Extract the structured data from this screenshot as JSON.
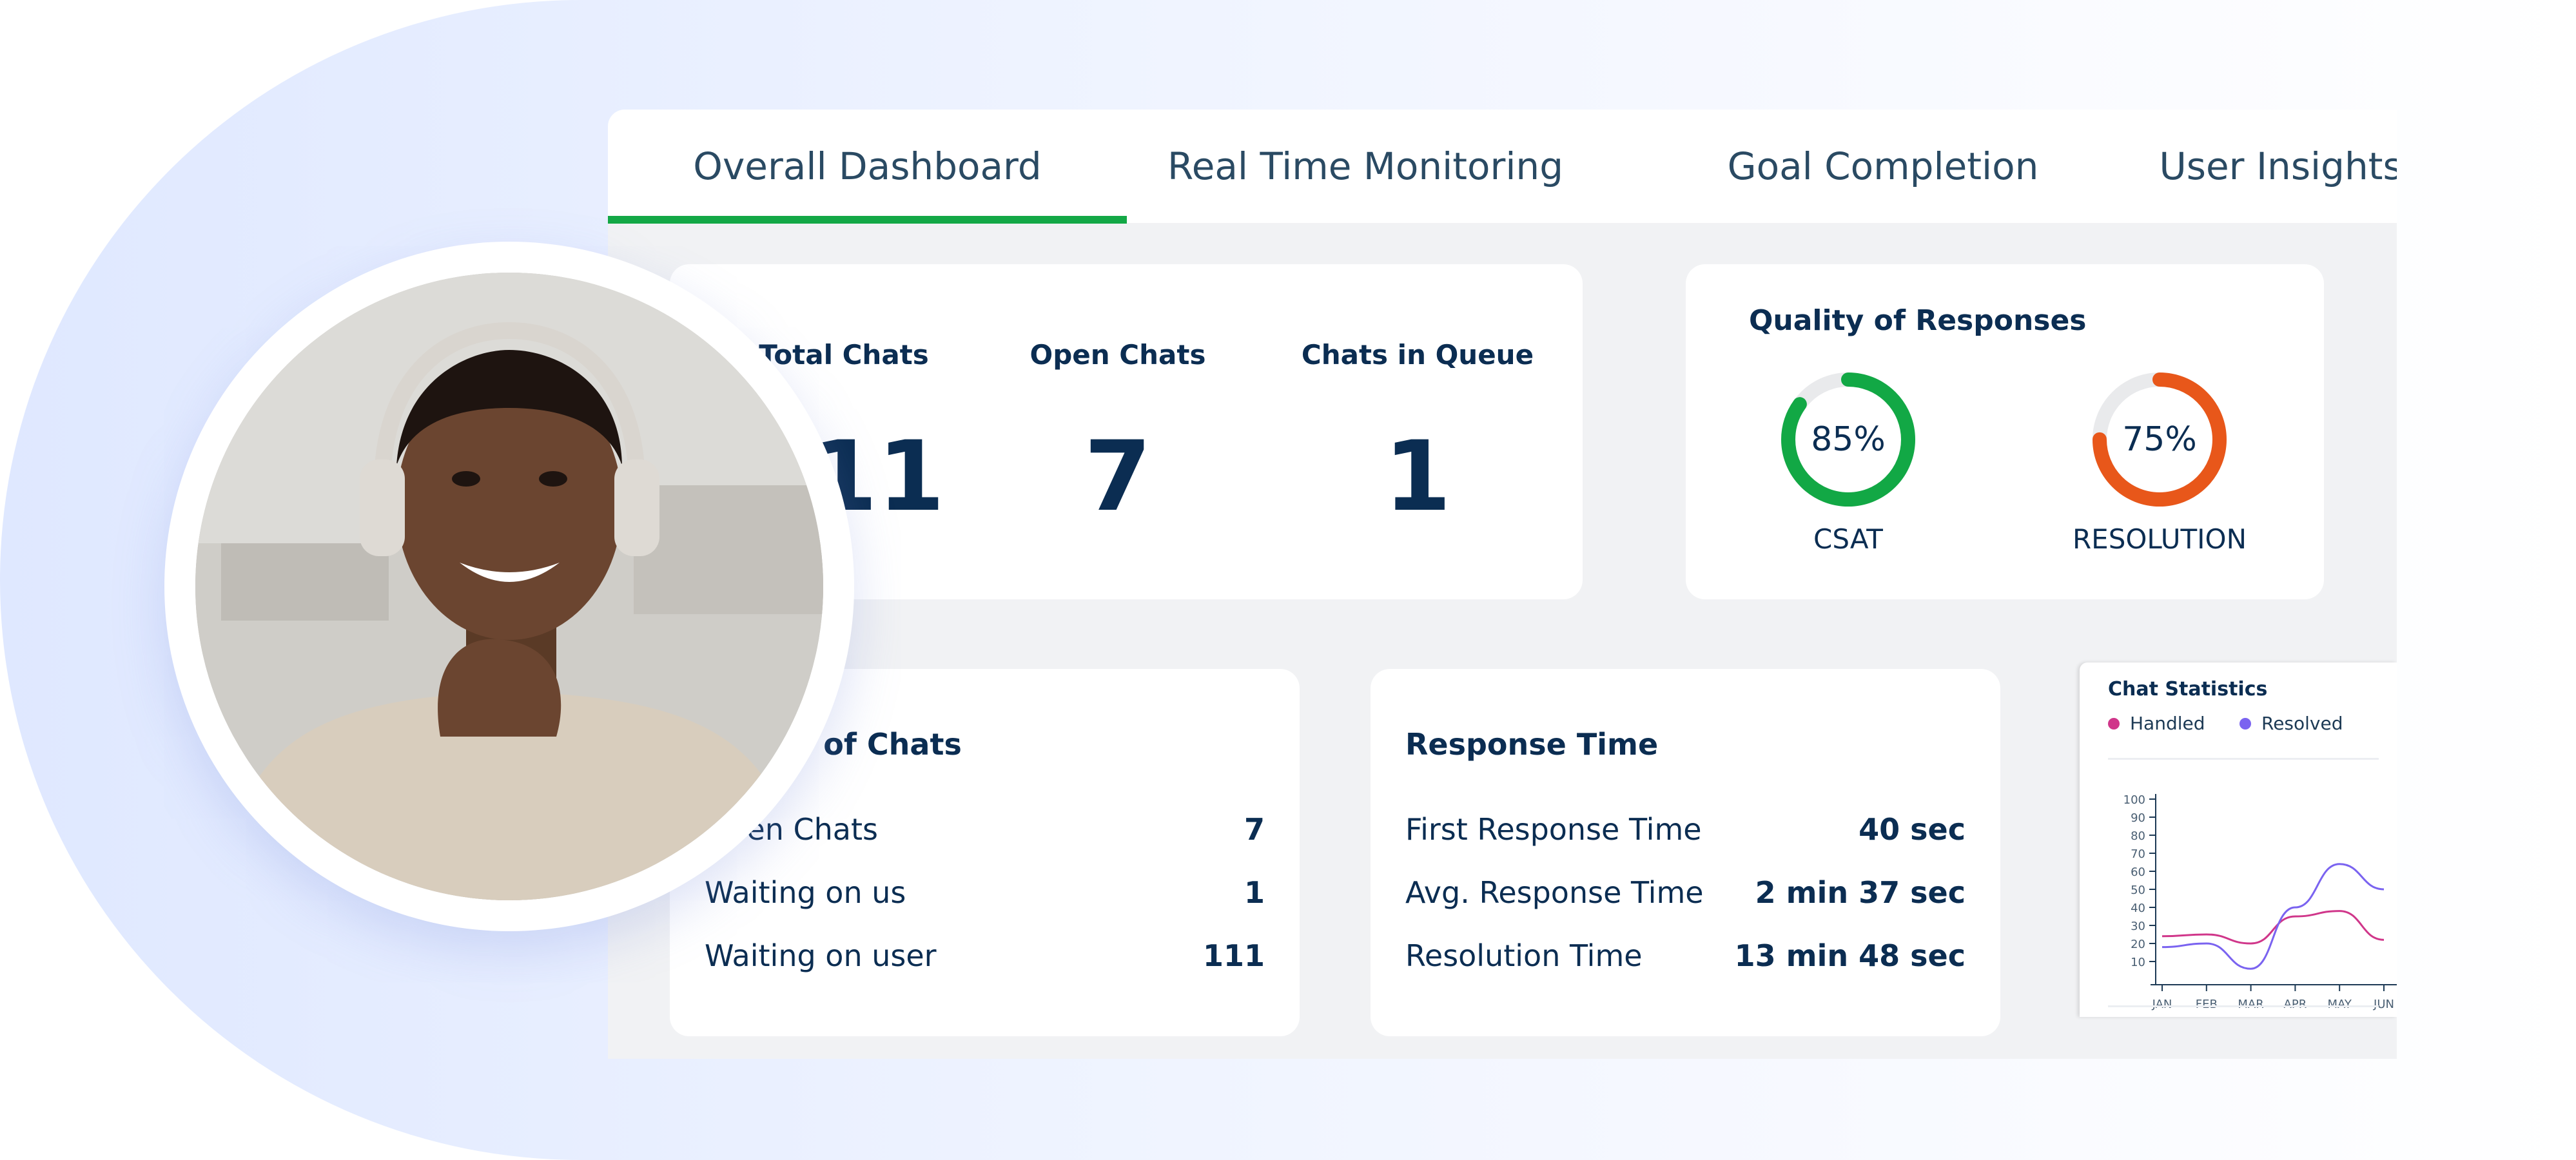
{
  "tabs": [
    {
      "label": "Overall Dashboard",
      "active": true
    },
    {
      "label": "Real Time Monitoring",
      "active": false
    },
    {
      "label": "Goal Completion",
      "active": false
    },
    {
      "label": "User Insights",
      "active": false
    }
  ],
  "stats": [
    {
      "label": "Total Chats",
      "value": "111"
    },
    {
      "label": "Open Chats",
      "value": "7"
    },
    {
      "label": "Chats in Queue",
      "value": "1"
    }
  ],
  "quality": {
    "title": "Quality of Responses",
    "csat": {
      "value": "85%",
      "percent": 85,
      "label": "CSAT",
      "color": "#12a845"
    },
    "resolution": {
      "value": "75%",
      "percent": 75,
      "label": "RESOLUTION",
      "color": "#e8571a"
    }
  },
  "status": {
    "title": "Status of Chats",
    "rows": [
      {
        "label": "Open Chats",
        "value": "7"
      },
      {
        "label": "Waiting on us",
        "value": "1"
      },
      {
        "label": "Waiting on user",
        "value": "111"
      }
    ]
  },
  "response": {
    "title": "Response Time",
    "rows": [
      {
        "label": "First Response Time",
        "value": "40 sec"
      },
      {
        "label": "Avg. Response Time",
        "value": "2 min 37 sec"
      },
      {
        "label": "Resolution Time",
        "value": "13 min 48 sec"
      }
    ]
  },
  "chart_data": {
    "type": "line",
    "title": "Chat Statistics",
    "categories": [
      "JAN",
      "FEB",
      "MAR",
      "APR",
      "MAY",
      "JUN"
    ],
    "ylim": [
      0,
      100
    ],
    "yticks": [
      10,
      20,
      30,
      40,
      50,
      60,
      70,
      80,
      90,
      100
    ],
    "legend": "top",
    "series": [
      {
        "name": "Handled",
        "color": "#d0368a",
        "values": [
          24,
          25,
          20,
          35,
          38,
          22
        ]
      },
      {
        "name": "Resolved",
        "color": "#7a63f0",
        "values": [
          18,
          20,
          6,
          40,
          64,
          50
        ]
      }
    ]
  },
  "colors": {
    "accent": "#13a846",
    "text": "#0b2d52",
    "panel_bg": "#f1f2f4"
  }
}
